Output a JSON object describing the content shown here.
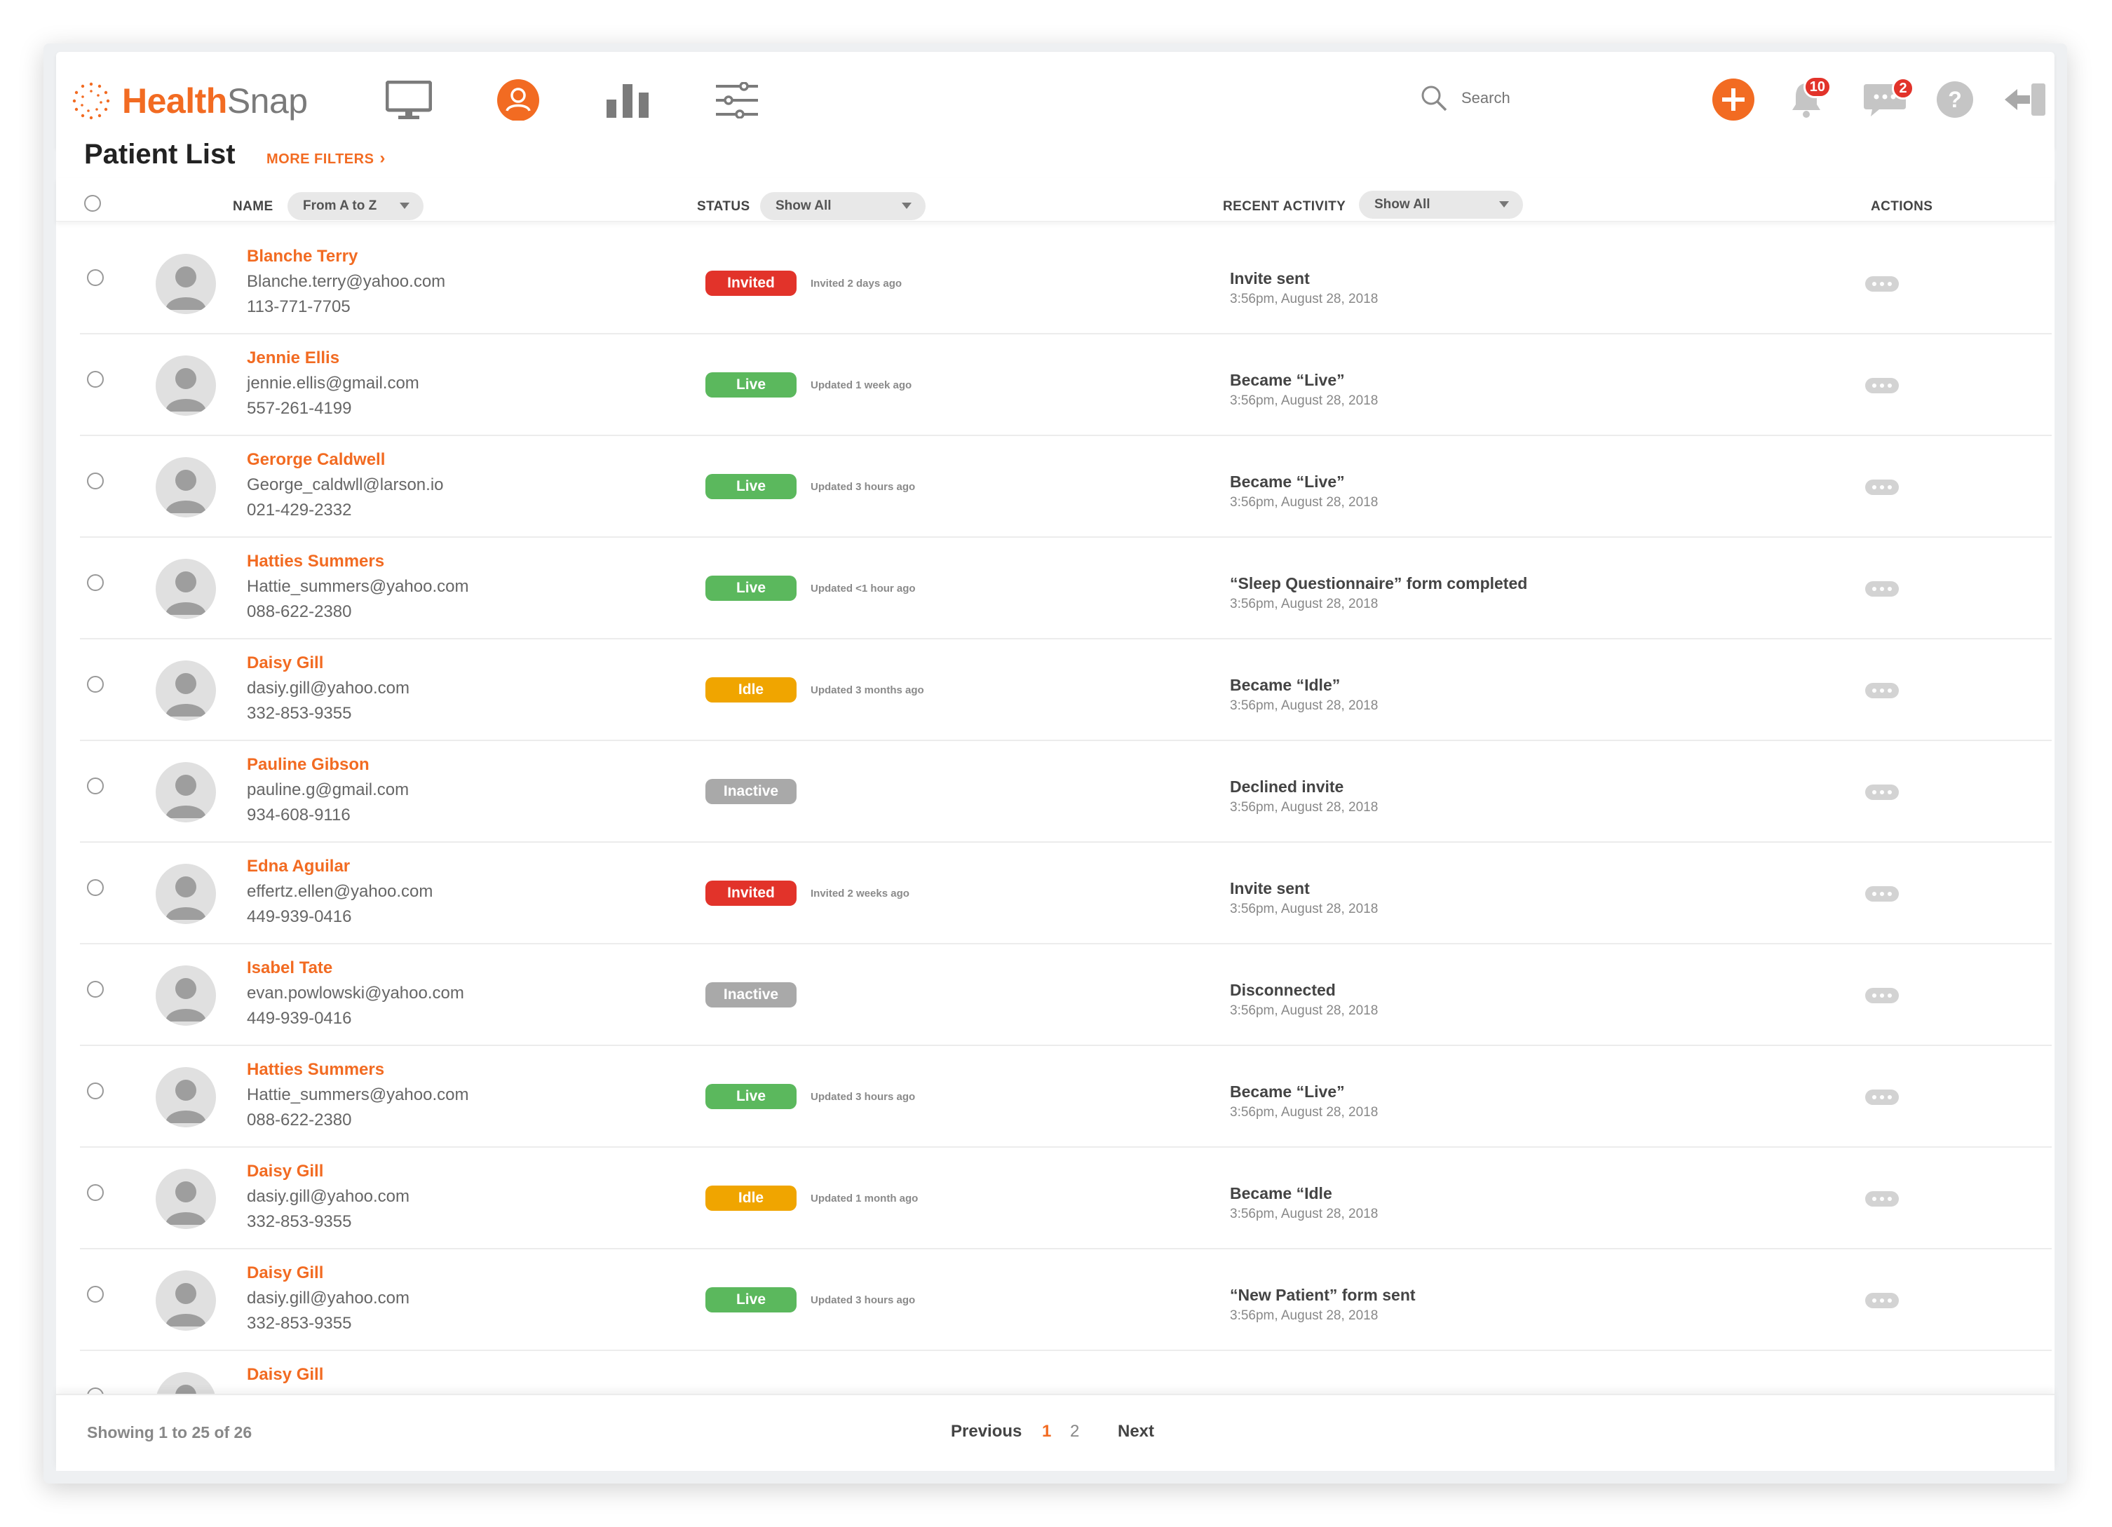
{
  "brand": {
    "name_part1": "Health",
    "name_part2": "Snap",
    "accent": "#f26b22"
  },
  "topnav": {
    "icons": [
      "monitor-icon",
      "patients-icon",
      "analytics-icon",
      "settings-sliders-icon"
    ],
    "active": "patients-icon",
    "search_placeholder": "Search",
    "notifications_count": "10",
    "messages_count": "2"
  },
  "page": {
    "title": "Patient List",
    "more_filters": "MORE FILTERS"
  },
  "table": {
    "col_name": "NAME",
    "name_sort": "From A to Z",
    "col_status": "STATUS",
    "status_filter": "Show All",
    "col_activity": "RECENT ACTIVITY",
    "activity_filter": "Show All",
    "col_actions": "ACTIONS"
  },
  "rows": [
    {
      "name": "Blanche Terry",
      "email": "Blanche.terry@yahoo.com",
      "phone": "113-771-7705",
      "status": "Invited",
      "status_class": "invited",
      "updated": "Invited 2 days ago",
      "activity": "Invite sent",
      "time": "3:56pm, August 28, 2018"
    },
    {
      "name": "Jennie Ellis",
      "email": "jennie.ellis@gmail.com",
      "phone": "557-261-4199",
      "status": "Live",
      "status_class": "live",
      "updated": "Updated 1 week ago",
      "activity": "Became “Live”",
      "time": "3:56pm, August 28, 2018"
    },
    {
      "name": "Gerorge Caldwell",
      "email": "George_caldwll@larson.io",
      "phone": "021-429-2332",
      "status": "Live",
      "status_class": "live",
      "updated": "Updated 3 hours ago",
      "activity": "Became “Live”",
      "time": "3:56pm, August 28, 2018"
    },
    {
      "name": "Hatties Summers",
      "email": "Hattie_summers@yahoo.com",
      "phone": "088-622-2380",
      "status": "Live",
      "status_class": "live",
      "updated": "Updated <1 hour ago",
      "activity": "“Sleep Questionnaire” form completed",
      "time": "3:56pm, August 28, 2018"
    },
    {
      "name": "Daisy Gill",
      "email": "dasiy.gill@yahoo.com",
      "phone": "332-853-9355",
      "status": "Idle",
      "status_class": "idle",
      "updated": "Updated 3 months ago",
      "activity": "Became “Idle”",
      "time": "3:56pm, August 28, 2018"
    },
    {
      "name": "Pauline Gibson",
      "email": "pauline.g@gmail.com",
      "phone": "934-608-9116",
      "status": "Inactive",
      "status_class": "inactive",
      "updated": "",
      "activity": "Declined invite",
      "time": "3:56pm, August 28, 2018"
    },
    {
      "name": "Edna Aguilar",
      "email": "effertz.ellen@yahoo.com",
      "phone": "449-939-0416",
      "status": "Invited",
      "status_class": "invited",
      "updated": "Invited 2 weeks ago",
      "activity": "Invite sent",
      "time": "3:56pm, August 28, 2018"
    },
    {
      "name": "Isabel Tate",
      "email": "evan.powlowski@yahoo.com",
      "phone": "449-939-0416",
      "status": "Inactive",
      "status_class": "inactive",
      "updated": "",
      "activity": "Disconnected",
      "time": "3:56pm, August 28, 2018"
    },
    {
      "name": "Hatties Summers",
      "email": "Hattie_summers@yahoo.com",
      "phone": "088-622-2380",
      "status": "Live",
      "status_class": "live",
      "updated": "Updated 3 hours ago",
      "activity": "Became “Live”",
      "time": "3:56pm, August 28, 2018"
    },
    {
      "name": "Daisy Gill",
      "email": "dasiy.gill@yahoo.com",
      "phone": "332-853-9355",
      "status": "Idle",
      "status_class": "idle",
      "updated": "Updated 1 month ago",
      "activity": "Became “Idle",
      "time": "3:56pm, August 28, 2018"
    },
    {
      "name": "Daisy Gill",
      "email": "dasiy.gill@yahoo.com",
      "phone": "332-853-9355",
      "status": "Live",
      "status_class": "live",
      "updated": "Updated 3 hours ago",
      "activity": "“New Patient” form sent",
      "time": "3:56pm, August 28, 2018"
    },
    {
      "name": "Daisy Gill",
      "email": "",
      "phone": "",
      "status": "",
      "status_class": "",
      "updated": "",
      "activity": "",
      "time": ""
    }
  ],
  "footer": {
    "showing": "Showing 1 to 25 of 26",
    "previous": "Previous",
    "pages": [
      "1",
      "2"
    ],
    "current_page": "1",
    "next": "Next"
  }
}
